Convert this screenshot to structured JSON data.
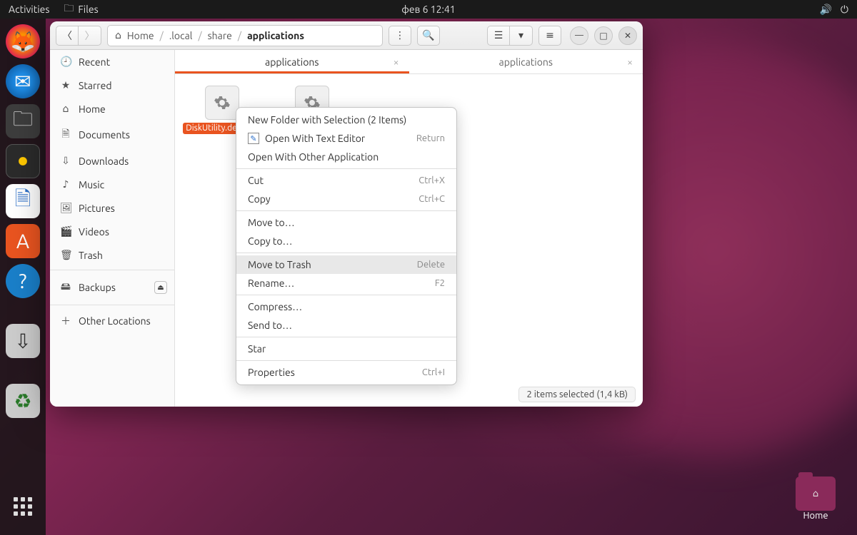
{
  "topbar": {
    "activities": "Activities",
    "files": "Files",
    "clock": "фев 6 12:41"
  },
  "dock": {
    "items": [
      "firefox",
      "thunderbird",
      "files",
      "rhythmbox",
      "writer",
      "software",
      "help",
      "usb",
      "trash"
    ],
    "apps": "apps"
  },
  "desktop": {
    "home": "Home"
  },
  "window": {
    "breadcrumb": {
      "home": "Home",
      "p1": ".local",
      "p2": "share",
      "p3": "applications"
    },
    "sidebar": [
      {
        "icon": "🕘",
        "label": "Recent"
      },
      {
        "icon": "★",
        "label": "Starred"
      },
      {
        "icon": "⌂",
        "label": "Home"
      },
      {
        "icon": "🗎",
        "label": "Documents"
      },
      {
        "icon": "⇩",
        "label": "Downloads"
      },
      {
        "icon": "♪",
        "label": "Music"
      },
      {
        "icon": "🖼",
        "label": "Pictures"
      },
      {
        "icon": "🎬",
        "label": "Videos"
      },
      {
        "icon": "🗑",
        "label": "Trash"
      },
      {
        "sep": true
      },
      {
        "icon": "🖴",
        "label": "Backups",
        "eject": true
      },
      {
        "sep": true
      },
      {
        "icon": "＋",
        "label": "Other Locations"
      }
    ],
    "tabs": [
      {
        "label": "applications",
        "active": true
      },
      {
        "label": "applications",
        "active": false
      }
    ],
    "files": [
      {
        "label": "DiskUtility.desktop",
        "selected": true
      },
      {
        "label": "",
        "selected": true
      }
    ],
    "status": "2 items selected  (1,4 kB)"
  },
  "context_menu": [
    {
      "label": "New Folder with Selection (2 Items)"
    },
    {
      "label": "Open With Text Editor",
      "icon": true,
      "accel": "Return"
    },
    {
      "label": "Open With Other Application"
    },
    {
      "sep": true
    },
    {
      "label": "Cut",
      "accel": "Ctrl+X"
    },
    {
      "label": "Copy",
      "accel": "Ctrl+C"
    },
    {
      "sep": true
    },
    {
      "label": "Move to…"
    },
    {
      "label": "Copy to…"
    },
    {
      "sep": true
    },
    {
      "label": "Move to Trash",
      "accel": "Delete",
      "hovered": true
    },
    {
      "label": "Rename…",
      "accel": "F2"
    },
    {
      "sep": true
    },
    {
      "label": "Compress…"
    },
    {
      "label": "Send to…"
    },
    {
      "sep": true
    },
    {
      "label": "Star"
    },
    {
      "sep": true
    },
    {
      "label": "Properties",
      "accel": "Ctrl+I"
    }
  ]
}
